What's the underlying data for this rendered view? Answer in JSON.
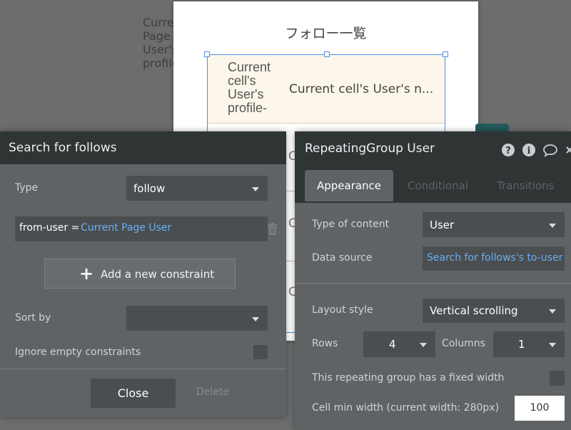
{
  "background": {
    "text_label_lines": [
      "Current",
      "Page",
      "User's",
      "profile"
    ],
    "popup": {
      "title": "フォロー一覧",
      "repeating_group": {
        "cell_image_text": "Current cell's User's profile-",
        "cell_name_text": "Current cell's User's n...",
        "partial_letters": [
          "C",
          "C",
          "C"
        ]
      }
    }
  },
  "search_panel": {
    "title": "Search for follows",
    "type_label": "Type",
    "type_value": "follow",
    "constraint": {
      "key": "from-user =",
      "value": "Current Page User"
    },
    "add_constraint_label": "Add a new constraint",
    "sort_by_label": "Sort by",
    "sort_by_value": "",
    "ignore_empty_label": "Ignore empty constraints",
    "close_label": "Close",
    "delete_label": "Delete"
  },
  "property_editor": {
    "title": "RepeatingGroup User",
    "tabs": [
      "Appearance",
      "Conditional",
      "Transitions"
    ],
    "active_tab": "Appearance",
    "type_of_content_label": "Type of content",
    "type_of_content_value": "User",
    "data_source_label": "Data source",
    "data_source_value": "Search for follows's to-user",
    "layout_style_label": "Layout style",
    "layout_style_value": "Vertical scrolling",
    "rows_label": "Rows",
    "rows_value": "4",
    "columns_label": "Columns",
    "columns_value": "1",
    "fixed_width_label": "This repeating group has a fixed width",
    "cell_min_width_label": "Cell min width (current width: 280px)",
    "cell_min_width_value": "100"
  },
  "colors": {
    "panel_bg": "#5f6365",
    "header_bg": "#2f3435",
    "field_bg": "#4a4e50",
    "link_blue": "#6aaef0",
    "selection_blue": "#4f8fe6"
  }
}
